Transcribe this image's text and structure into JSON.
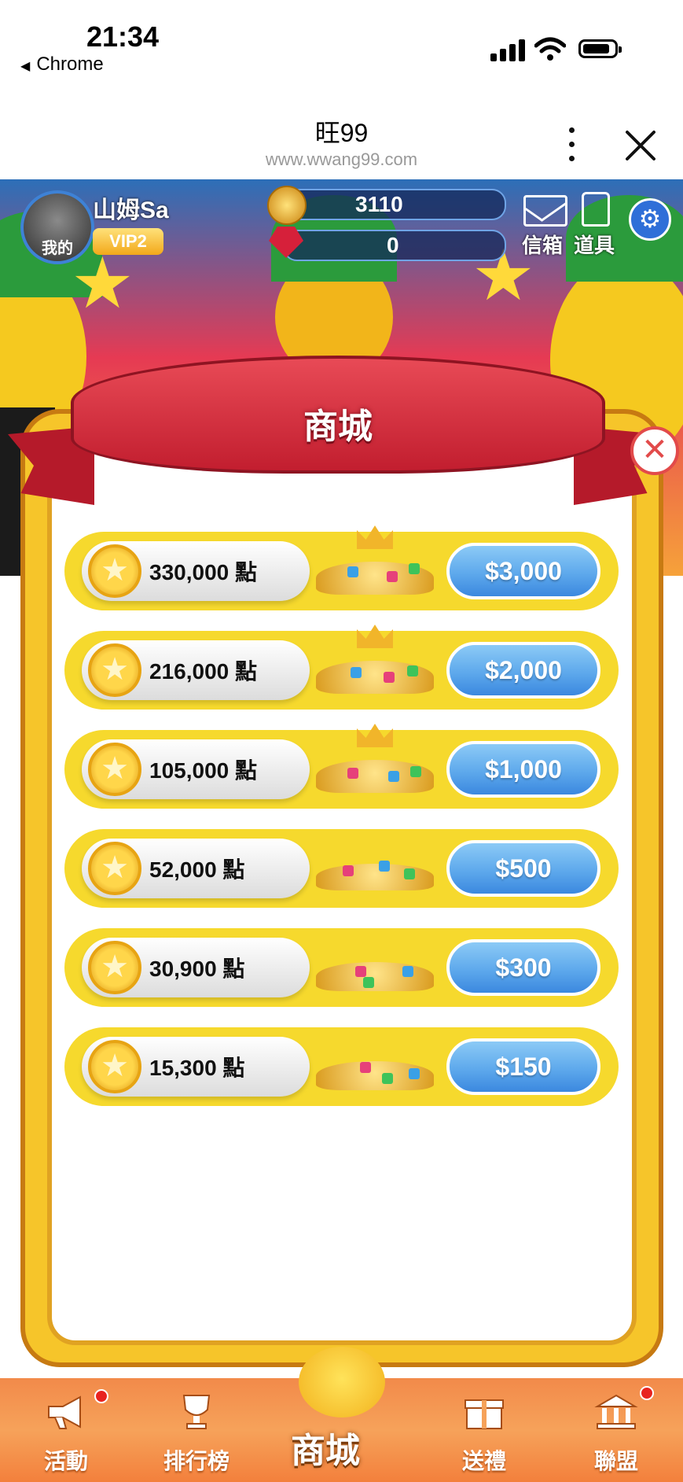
{
  "status_bar": {
    "time": "21:34",
    "back_app": "Chrome"
  },
  "browser": {
    "title": "旺99",
    "url": "www.wwang99.com"
  },
  "hud": {
    "avatar_label": "我的",
    "username": "山姆Sa",
    "vip": "VIP2",
    "coins": "3110",
    "gems": "0",
    "mail_label": "信箱",
    "items_label": "道具"
  },
  "shop": {
    "title": "商城",
    "packages": [
      {
        "points": "330,000 點",
        "price": "$3,000"
      },
      {
        "points": "216,000 點",
        "price": "$2,000"
      },
      {
        "points": "105,000 點",
        "price": "$1,000"
      },
      {
        "points": "52,000 點",
        "price": "$500"
      },
      {
        "points": "30,900 點",
        "price": "$300"
      },
      {
        "points": "15,300 點",
        "price": "$150"
      }
    ]
  },
  "nav": {
    "items": [
      {
        "label": "活動",
        "icon": "megaphone-icon"
      },
      {
        "label": "排行榜",
        "icon": "trophy-icon"
      },
      {
        "label": "商城",
        "icon": "pineapple-icon"
      },
      {
        "label": "送禮",
        "icon": "gift-icon"
      },
      {
        "label": "聯盟",
        "icon": "bank-icon"
      }
    ]
  },
  "colors": {
    "accent_red": "#c21e2f",
    "gold": "#f6c52a",
    "price_blue": "#5ea9ec",
    "nav_orange": "#f28a4a"
  }
}
